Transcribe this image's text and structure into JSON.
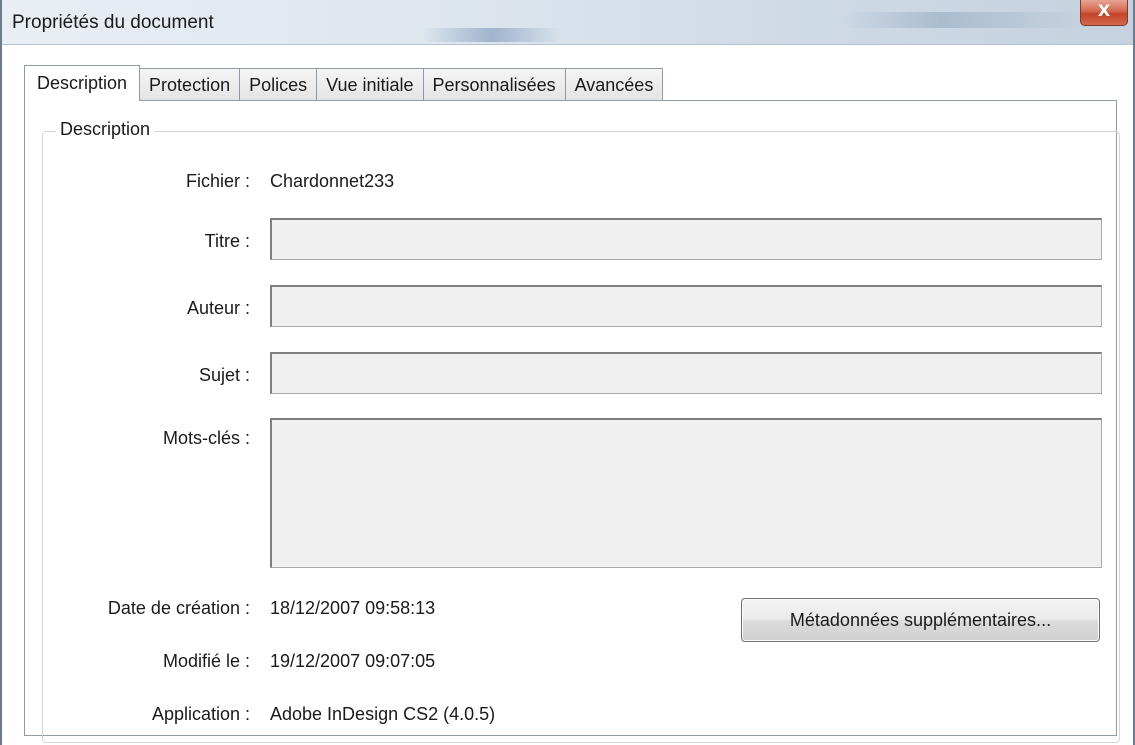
{
  "window": {
    "title": "Propriétés du document",
    "close_label": "X"
  },
  "tabs": [
    {
      "label": "Description",
      "active": true
    },
    {
      "label": "Protection",
      "active": false
    },
    {
      "label": "Polices",
      "active": false
    },
    {
      "label": "Vue initiale",
      "active": false
    },
    {
      "label": "Personnalisées",
      "active": false
    },
    {
      "label": "Avancées",
      "active": false
    }
  ],
  "group": {
    "title": "Description"
  },
  "fields": {
    "file_label": "Fichier :",
    "file_value": "Chardonnet233",
    "title_label": "Titre :",
    "title_value": "",
    "author_label": "Auteur :",
    "author_value": "",
    "subject_label": "Sujet :",
    "subject_value": "",
    "keywords_label": "Mots-clés :",
    "keywords_value": "",
    "created_label": "Date de création :",
    "created_value": "18/12/2007 09:58:13",
    "modified_label": "Modifié le :",
    "modified_value": "19/12/2007 09:07:05",
    "application_label": "Application :",
    "application_value": "Adobe InDesign CS2 (4.0.5)"
  },
  "buttons": {
    "metadata_label": "Métadonnées supplémentaires..."
  },
  "colors": {
    "close_button": "#c9482c",
    "field_background": "#f0f0f0",
    "tab_border": "#8e9aa7"
  }
}
